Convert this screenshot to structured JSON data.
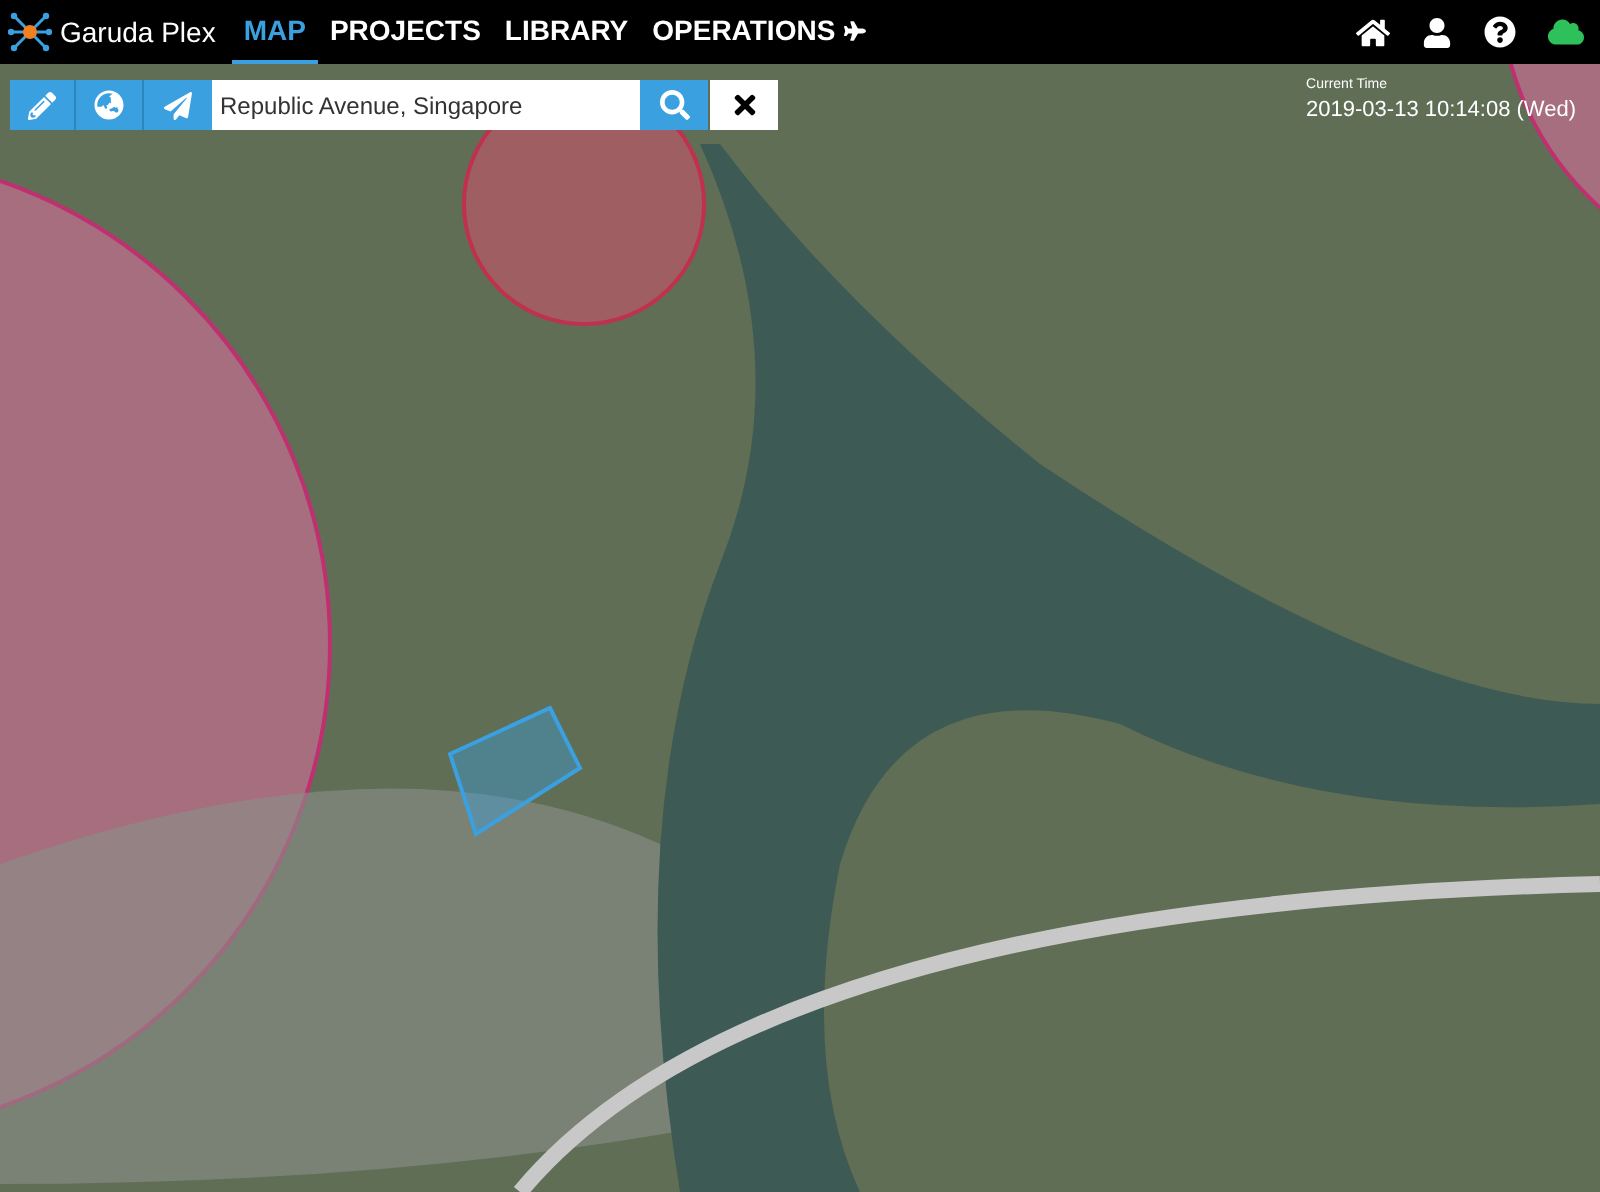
{
  "app": {
    "title": "Garuda Plex"
  },
  "nav": [
    {
      "label": "MAP",
      "selected": true
    },
    {
      "label": "PROJECTS",
      "selected": false
    },
    {
      "label": "LIBRARY",
      "selected": false
    },
    {
      "label": "OPERATIONS",
      "selected": false
    }
  ],
  "search": {
    "value": "Republic Avenue, Singapore"
  },
  "clock": {
    "label": "Current Time",
    "value": "2019-03-13 10:14:08 (Wed)"
  },
  "status": {
    "online": true
  }
}
